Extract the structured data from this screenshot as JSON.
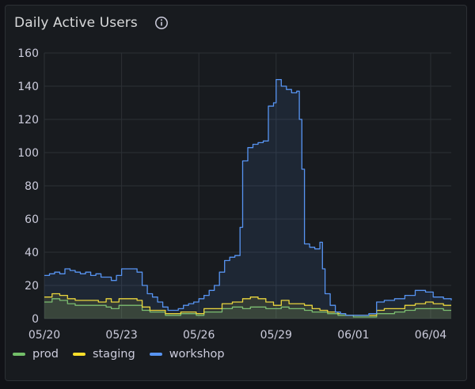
{
  "panel": {
    "title": "Daily Active Users",
    "info_icon": "info-circle-icon"
  },
  "colors": {
    "prod": "#73bf69",
    "staging": "#fade2a",
    "workshop": "#5794f2",
    "grid": "#2c3035",
    "tick": "#ccccdc"
  },
  "chart_data": {
    "type": "line",
    "x_unit": "day",
    "x_tick_labels": [
      "05/20",
      "05/23",
      "05/26",
      "05/29",
      "06/01",
      "06/04"
    ],
    "x_tick_days": [
      0,
      3,
      6,
      9,
      12,
      15
    ],
    "xlim_days": [
      0,
      15.8
    ],
    "ylim": [
      0,
      160
    ],
    "y_ticks": [
      0,
      20,
      40,
      60,
      80,
      100,
      120,
      140,
      160
    ],
    "grid": true,
    "legend_position": "bottom-left",
    "series": [
      {
        "name": "prod",
        "color": "#73bf69",
        "points": [
          [
            0,
            10
          ],
          [
            0.3,
            12
          ],
          [
            0.6,
            11
          ],
          [
            0.9,
            9
          ],
          [
            1.2,
            8
          ],
          [
            1.5,
            8
          ],
          [
            1.8,
            8
          ],
          [
            2.1,
            8
          ],
          [
            2.4,
            7
          ],
          [
            2.6,
            6
          ],
          [
            2.9,
            8
          ],
          [
            3.3,
            8
          ],
          [
            3.6,
            8
          ],
          [
            3.8,
            5
          ],
          [
            4.1,
            4
          ],
          [
            4.4,
            4
          ],
          [
            4.7,
            2
          ],
          [
            5.0,
            2
          ],
          [
            5.3,
            3
          ],
          [
            5.6,
            3
          ],
          [
            5.9,
            2
          ],
          [
            6.2,
            4
          ],
          [
            6.6,
            4
          ],
          [
            6.9,
            6
          ],
          [
            7.3,
            7
          ],
          [
            7.7,
            6
          ],
          [
            8.0,
            7
          ],
          [
            8.3,
            7
          ],
          [
            8.6,
            6
          ],
          [
            8.9,
            6
          ],
          [
            9.2,
            7
          ],
          [
            9.5,
            6
          ],
          [
            9.8,
            6
          ],
          [
            10.1,
            5
          ],
          [
            10.4,
            4
          ],
          [
            10.7,
            4
          ],
          [
            11.0,
            3
          ],
          [
            11.4,
            2
          ],
          [
            11.7,
            2
          ],
          [
            12.0,
            1
          ],
          [
            12.3,
            1
          ],
          [
            12.6,
            1
          ],
          [
            12.9,
            3
          ],
          [
            13.2,
            3
          ],
          [
            13.6,
            4
          ],
          [
            14.0,
            5
          ],
          [
            14.4,
            6
          ],
          [
            14.8,
            6
          ],
          [
            15.1,
            6
          ],
          [
            15.5,
            5
          ],
          [
            15.8,
            5
          ]
        ]
      },
      {
        "name": "staging",
        "color": "#fade2a",
        "points": [
          [
            0,
            13
          ],
          [
            0.3,
            15
          ],
          [
            0.6,
            14
          ],
          [
            0.9,
            12
          ],
          [
            1.2,
            11
          ],
          [
            1.5,
            11
          ],
          [
            1.8,
            11
          ],
          [
            2.1,
            10
          ],
          [
            2.4,
            12
          ],
          [
            2.6,
            10
          ],
          [
            2.9,
            12
          ],
          [
            3.3,
            12
          ],
          [
            3.6,
            11
          ],
          [
            3.8,
            7
          ],
          [
            4.1,
            5
          ],
          [
            4.4,
            5
          ],
          [
            4.7,
            3
          ],
          [
            5.0,
            3
          ],
          [
            5.3,
            4
          ],
          [
            5.6,
            4
          ],
          [
            5.9,
            3
          ],
          [
            6.2,
            6
          ],
          [
            6.6,
            6
          ],
          [
            6.9,
            9
          ],
          [
            7.3,
            10
          ],
          [
            7.7,
            12
          ],
          [
            8.0,
            13
          ],
          [
            8.3,
            12
          ],
          [
            8.6,
            10
          ],
          [
            8.9,
            8
          ],
          [
            9.2,
            11
          ],
          [
            9.5,
            9
          ],
          [
            9.8,
            9
          ],
          [
            10.1,
            8
          ],
          [
            10.4,
            6
          ],
          [
            10.7,
            5
          ],
          [
            11.0,
            4
          ],
          [
            11.4,
            3
          ],
          [
            11.7,
            2
          ],
          [
            12.0,
            2
          ],
          [
            12.3,
            2
          ],
          [
            12.6,
            2
          ],
          [
            12.9,
            5
          ],
          [
            13.2,
            6
          ],
          [
            13.6,
            6
          ],
          [
            14.0,
            8
          ],
          [
            14.4,
            9
          ],
          [
            14.8,
            10
          ],
          [
            15.1,
            9
          ],
          [
            15.5,
            8
          ],
          [
            15.8,
            8
          ]
        ]
      },
      {
        "name": "workshop",
        "color": "#5794f2",
        "points": [
          [
            0,
            26
          ],
          [
            0.2,
            27
          ],
          [
            0.4,
            28
          ],
          [
            0.6,
            27
          ],
          [
            0.8,
            30
          ],
          [
            1.0,
            29
          ],
          [
            1.2,
            28
          ],
          [
            1.4,
            27
          ],
          [
            1.6,
            28
          ],
          [
            1.8,
            26
          ],
          [
            2.0,
            27
          ],
          [
            2.2,
            25
          ],
          [
            2.4,
            25
          ],
          [
            2.6,
            23
          ],
          [
            2.8,
            26
          ],
          [
            3.0,
            30
          ],
          [
            3.2,
            30
          ],
          [
            3.4,
            30
          ],
          [
            3.6,
            28
          ],
          [
            3.8,
            20
          ],
          [
            4.0,
            15
          ],
          [
            4.2,
            13
          ],
          [
            4.4,
            10
          ],
          [
            4.6,
            7
          ],
          [
            4.8,
            5
          ],
          [
            5.0,
            5
          ],
          [
            5.2,
            6
          ],
          [
            5.4,
            8
          ],
          [
            5.6,
            9
          ],
          [
            5.8,
            10
          ],
          [
            6.0,
            12
          ],
          [
            6.2,
            14
          ],
          [
            6.4,
            17
          ],
          [
            6.6,
            20
          ],
          [
            6.8,
            28
          ],
          [
            7.0,
            35
          ],
          [
            7.2,
            37
          ],
          [
            7.4,
            38
          ],
          [
            7.6,
            55
          ],
          [
            7.7,
            95
          ],
          [
            7.9,
            103
          ],
          [
            8.1,
            105
          ],
          [
            8.3,
            106
          ],
          [
            8.5,
            107
          ],
          [
            8.7,
            128
          ],
          [
            8.9,
            130
          ],
          [
            9.0,
            144
          ],
          [
            9.2,
            140
          ],
          [
            9.4,
            138
          ],
          [
            9.6,
            136
          ],
          [
            9.8,
            137
          ],
          [
            9.9,
            120
          ],
          [
            10.0,
            90
          ],
          [
            10.1,
            45
          ],
          [
            10.3,
            43
          ],
          [
            10.5,
            42
          ],
          [
            10.7,
            46
          ],
          [
            10.8,
            30
          ],
          [
            10.9,
            15
          ],
          [
            11.1,
            8
          ],
          [
            11.3,
            4
          ],
          [
            11.5,
            3
          ],
          [
            11.7,
            2
          ],
          [
            12.0,
            2
          ],
          [
            12.3,
            2
          ],
          [
            12.6,
            3
          ],
          [
            12.9,
            10
          ],
          [
            13.2,
            11
          ],
          [
            13.6,
            12
          ],
          [
            14.0,
            14
          ],
          [
            14.4,
            17
          ],
          [
            14.8,
            16
          ],
          [
            15.1,
            13
          ],
          [
            15.5,
            12
          ],
          [
            15.8,
            11
          ]
        ]
      }
    ]
  }
}
